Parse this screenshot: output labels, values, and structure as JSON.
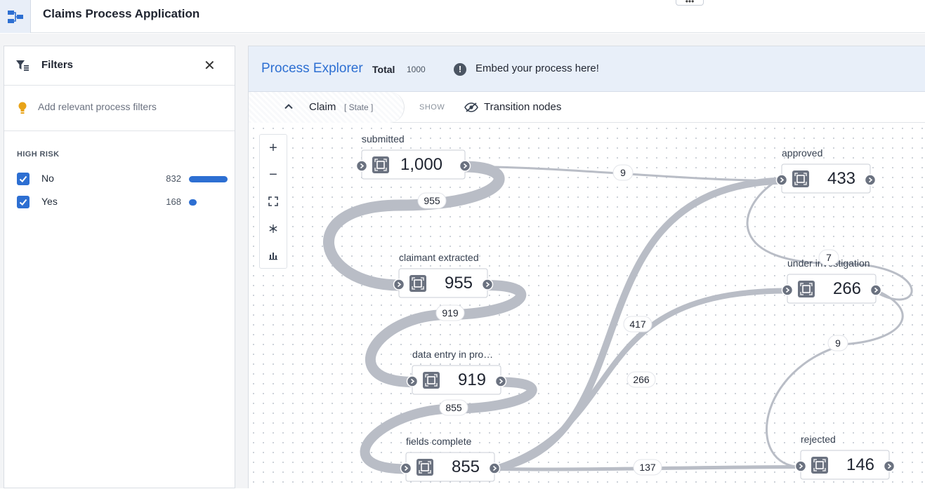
{
  "app": {
    "title": "Claims Process Application",
    "more_label": "•••"
  },
  "filters": {
    "title": "Filters",
    "hint": "Add relevant process filters",
    "section_label": "HIGH RISK",
    "rows": [
      {
        "label": "No",
        "count": "832",
        "fraction": 0.832
      },
      {
        "label": "Yes",
        "count": "168",
        "fraction": 0.168
      }
    ]
  },
  "explorer": {
    "title": "Process Explorer",
    "total_label": "Total",
    "total_value": "1000",
    "info_icon": "!",
    "embed_text": "Embed your process here!",
    "object_label": "Claim",
    "object_sub": "[ State ]",
    "show_label": "SHOW",
    "transition_label": "Transition nodes"
  },
  "graph": {
    "nodes": [
      {
        "id": "submitted",
        "label": "submitted",
        "value": "1,000"
      },
      {
        "id": "claimant",
        "label": "claimant extracted",
        "value": "955"
      },
      {
        "id": "dataentry",
        "label": "data entry in pro…",
        "value": "919"
      },
      {
        "id": "fields",
        "label": "fields complete",
        "value": "855"
      },
      {
        "id": "approved",
        "label": "approved",
        "value": "433"
      },
      {
        "id": "investigation",
        "label": "under investigation",
        "value": "266"
      },
      {
        "id": "rejected",
        "label": "rejected",
        "value": "146"
      }
    ],
    "edges": [
      {
        "from": "submitted",
        "to": "claimant",
        "label": "955"
      },
      {
        "from": "submitted",
        "to": "approved",
        "label": "9"
      },
      {
        "from": "claimant",
        "to": "dataentry",
        "label": "919"
      },
      {
        "from": "dataentry",
        "to": "fields",
        "label": "855"
      },
      {
        "from": "fields",
        "to": "approved",
        "label": "417"
      },
      {
        "from": "fields",
        "to": "investigation",
        "label": "266"
      },
      {
        "from": "fields",
        "to": "rejected",
        "label": "137"
      },
      {
        "from": "approved",
        "to": "investigation",
        "label": "7"
      },
      {
        "from": "investigation",
        "to": "rejected",
        "label": "9"
      }
    ]
  },
  "colors": {
    "accent": "#2d6fd2",
    "edge": "#b9bdc6",
    "warning": "#e8a317"
  }
}
